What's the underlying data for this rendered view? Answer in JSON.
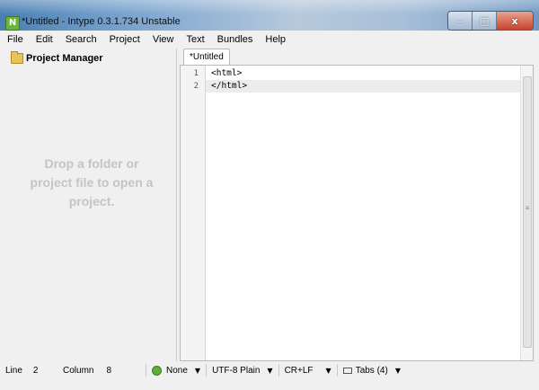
{
  "window": {
    "title": "*Untitled - Intype 0.3.1.734 Unstable",
    "icon": "intype-app-icon",
    "controls": {
      "minimize": "–",
      "maximize": "□",
      "close": "x"
    }
  },
  "menubar": {
    "items": [
      "File",
      "Edit",
      "Search",
      "Project",
      "View",
      "Text",
      "Bundles",
      "Help"
    ]
  },
  "project_manager": {
    "title": "Project Manager",
    "hint_lines": [
      "Drop a folder or",
      "project file to open a",
      "project."
    ]
  },
  "editor": {
    "tab_label": "*Untitled",
    "lines": [
      {
        "number": "1",
        "text": "<html>"
      },
      {
        "number": "2",
        "text": "</html>"
      }
    ],
    "active_line_index": 1
  },
  "statusbar": {
    "line_label": "Line",
    "line_value": "2",
    "column_label": "Column",
    "column_value": "8",
    "syntax": "None",
    "encoding": "UTF-8 Plain",
    "line_endings": "CR+LF",
    "tabs": "Tabs (4)"
  }
}
